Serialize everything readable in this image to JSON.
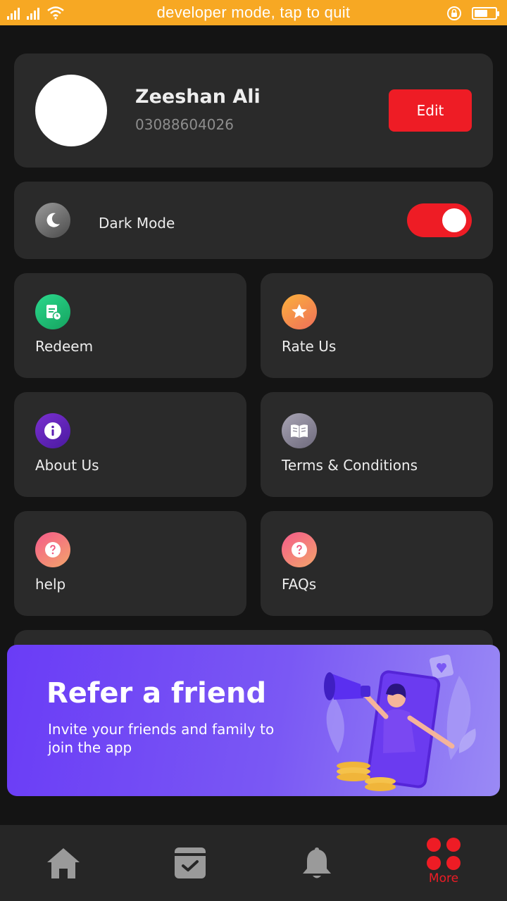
{
  "status_bar": {
    "text": "developer mode, tap to quit",
    "background": "#f7a823"
  },
  "profile": {
    "name": "Zeeshan Ali",
    "phone": "03088604026",
    "edit_label": "Edit"
  },
  "dark_mode": {
    "label": "Dark Mode",
    "enabled": true
  },
  "menu": [
    {
      "label": "Redeem",
      "icon": "redeem-icon",
      "color": "#22c07a"
    },
    {
      "label": "Rate Us",
      "icon": "star-icon",
      "color": "#f7a23a"
    },
    {
      "label": "About Us",
      "icon": "info-icon",
      "color": "#5a1bb0"
    },
    {
      "label": "Terms & Conditions",
      "icon": "book-icon",
      "color": "#8a8696"
    },
    {
      "label": "help",
      "icon": "question-icon",
      "color": "#f0567d"
    },
    {
      "label": "FAQs",
      "icon": "question-icon",
      "color": "#f0567d"
    }
  ],
  "refer": {
    "title": "Refer a friend",
    "subtitle": "Invite your friends and family to join the app"
  },
  "bottom_nav": {
    "items": [
      "home-icon",
      "tasks-icon",
      "bell-icon",
      "more-icon"
    ],
    "more_label": "More",
    "accent": "#ee1c25"
  }
}
